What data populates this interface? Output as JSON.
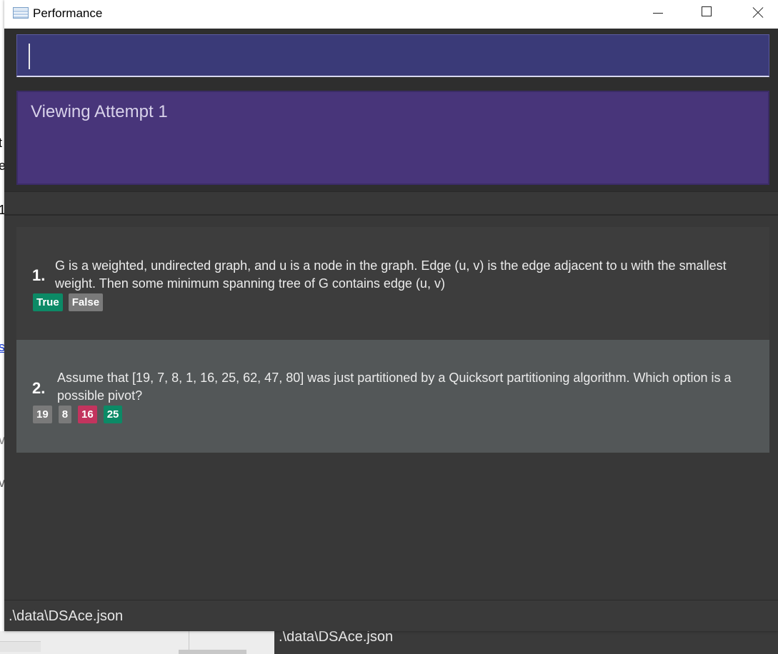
{
  "window": {
    "title": "Performance"
  },
  "background_fragments": {
    "left_glyphs": [
      "t",
      "e",
      "1",
      "s",
      "v",
      "v"
    ],
    "status_path": ".\\data\\DSAce.json"
  },
  "command_box": {
    "value": "",
    "placeholder": ""
  },
  "result_display": {
    "text": "Viewing Attempt 1"
  },
  "questions": [
    {
      "number": "1.",
      "text": "G is a weighted, undirected graph, and u is a node in the graph. Edge (u, v) is the edge adjacent to u with the smallest weight. Then some minimum spanning tree of G contains edge (u, v)",
      "options": [
        {
          "label": "True",
          "status": "correct"
        },
        {
          "label": "False",
          "status": "neutral"
        }
      ]
    },
    {
      "number": "2.",
      "text": "Assume that [19, 7, 8, 1, 16, 25, 62, 47, 80] was just partitioned by a Quicksort partitioning algorithm. Which option is a possible pivot?",
      "options": [
        {
          "label": "19",
          "status": "neutral"
        },
        {
          "label": "8",
          "status": "neutral"
        },
        {
          "label": "16",
          "status": "wrong"
        },
        {
          "label": "25",
          "status": "correct"
        }
      ]
    }
  ],
  "status_bar": {
    "path": ".\\data\\DSAce.json"
  },
  "colors": {
    "correct": "#0c8a66",
    "wrong": "#c2345e",
    "neutral": "#7a7a7a",
    "command_box": "#3a3a78",
    "result_box": "#48357a"
  }
}
